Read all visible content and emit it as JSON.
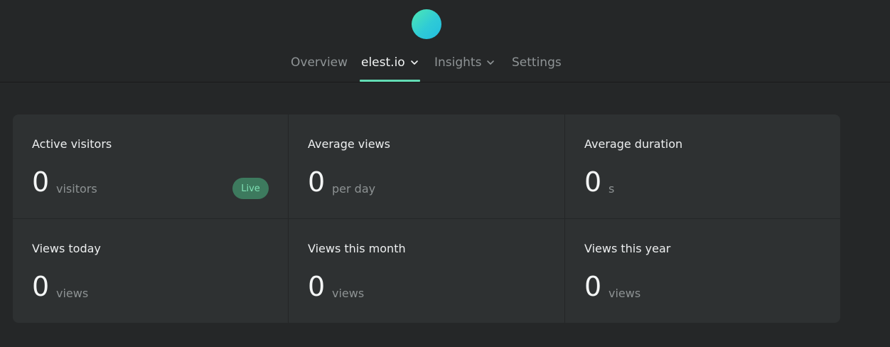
{
  "nav": {
    "items": [
      {
        "label": "Overview",
        "active": false,
        "dropdown": false
      },
      {
        "label": "elest.io",
        "active": true,
        "dropdown": true
      },
      {
        "label": "Insights",
        "active": false,
        "dropdown": true
      },
      {
        "label": "Settings",
        "active": false,
        "dropdown": false
      }
    ]
  },
  "stats": {
    "active_visitors": {
      "label": "Active visitors",
      "value": "0",
      "unit": "visitors",
      "badge": "Live"
    },
    "average_views": {
      "label": "Average views",
      "value": "0",
      "unit": "per day"
    },
    "average_duration": {
      "label": "Average duration",
      "value": "0",
      "unit": "s"
    },
    "views_today": {
      "label": "Views today",
      "value": "0",
      "unit": "views"
    },
    "views_this_month": {
      "label": "Views this month",
      "value": "0",
      "unit": "views"
    },
    "views_this_year": {
      "label": "Views this year",
      "value": "0",
      "unit": "views"
    }
  },
  "colors": {
    "accent": "#63dbb4",
    "live_badge_bg": "#3d7a5e",
    "live_badge_text": "#7fe0b4"
  }
}
